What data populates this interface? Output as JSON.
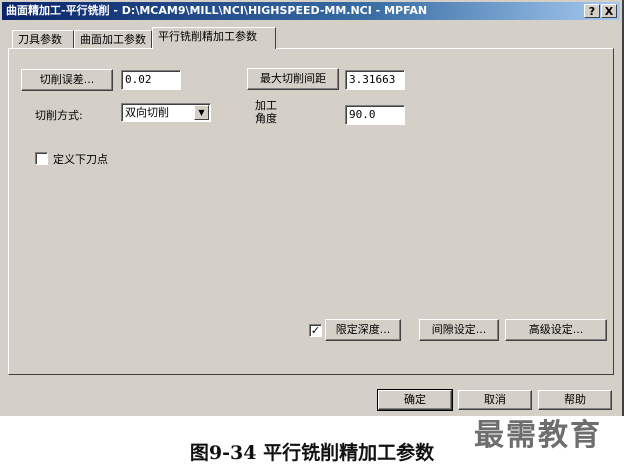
{
  "window": {
    "title": "曲面精加工-平行铣削 - D:\\MCAM9\\MILL\\NCI\\HIGHSPEED-MM.NCI - MPFAN",
    "help_btn": "?",
    "close_btn": "X"
  },
  "tabs": [
    {
      "label": "刀具参数",
      "active": false
    },
    {
      "label": "曲面加工参数",
      "active": false
    },
    {
      "label": "平行铣削精加工参数",
      "active": true
    }
  ],
  "params": {
    "tolerance_button": "切削误差...",
    "tolerance_value": "0.02",
    "max_stepover_button": "最大切削间距",
    "max_stepover_value": "3.31663",
    "cut_method_label": "切削方式:",
    "cut_method_value": "双向切削",
    "angle_label_line1": "加工",
    "angle_label_line2": "角度",
    "angle_value": "90.0",
    "define_plunge_label": "定义下刀点",
    "define_plunge_checked": false,
    "limit_depth_checked": true,
    "limit_depth_button": "限定深度...",
    "gap_settings_button": "间隙设定...",
    "advanced_settings_button": "高级设定..."
  },
  "footer": {
    "ok": "确定",
    "cancel": "取消",
    "help": "帮助"
  },
  "watermark": "最需教育",
  "caption": "图9-34  平行铣削精加工参数"
}
